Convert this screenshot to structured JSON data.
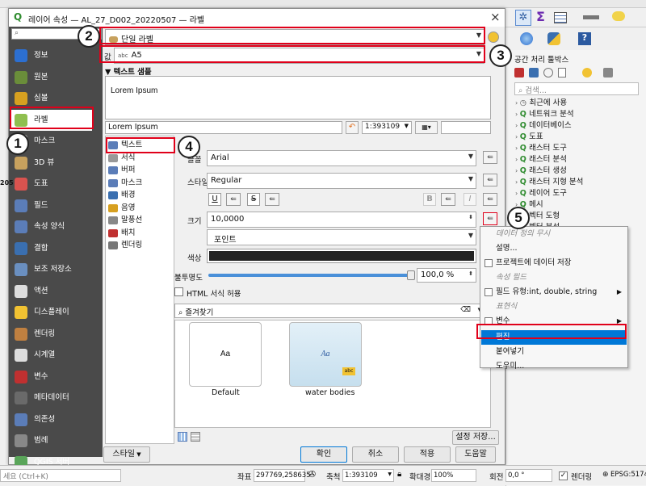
{
  "dialog": {
    "title": "레이어 속성 — AL_27_D002_20220507 — 라벨",
    "close": "×"
  },
  "sidebar": {
    "search_placeholder": "",
    "items": [
      {
        "label": "정보",
        "icon": "info-icon",
        "color": "#2c6fd1"
      },
      {
        "label": "원본",
        "icon": "source-icon",
        "color": "#6a8d3a"
      },
      {
        "label": "심볼",
        "icon": "symbology-icon",
        "color": "#d7a020"
      },
      {
        "label": "라벨",
        "icon": "labels-icon",
        "color": "#8fbf4f"
      },
      {
        "label": "마스크",
        "icon": "mask-icon",
        "color": "#999"
      },
      {
        "label": "3D 뷰",
        "icon": "3d-view-icon",
        "color": "#c7a15e"
      },
      {
        "label": "도표",
        "icon": "diagram-icon",
        "color": "#d9534f"
      },
      {
        "label": "필드",
        "icon": "fields-icon",
        "color": "#5b7db8"
      },
      {
        "label": "속성 양식",
        "icon": "attributes-form-icon",
        "color": "#5b7db8"
      },
      {
        "label": "결합",
        "icon": "joins-icon",
        "color": "#3a6fb0"
      },
      {
        "label": "보조 저장소",
        "icon": "auxiliary-storage-icon",
        "color": "#6a8fc0"
      },
      {
        "label": "액션",
        "icon": "actions-icon",
        "color": "#ddd"
      },
      {
        "label": "디스플레이",
        "icon": "display-icon",
        "color": "#f1c232"
      },
      {
        "label": "렌더링",
        "icon": "rendering-icon",
        "color": "#c08040"
      },
      {
        "label": "시계열",
        "icon": "temporal-icon",
        "color": "#ddd"
      },
      {
        "label": "변수",
        "icon": "variables-icon",
        "color": "#c03030"
      },
      {
        "label": "메타데이터",
        "icon": "metadata-icon",
        "color": "#6a6a6a"
      },
      {
        "label": "의존성",
        "icon": "dependencies-icon",
        "color": "#5b7db8"
      },
      {
        "label": "범례",
        "icon": "legend-icon",
        "color": "#888"
      },
      {
        "label": "QGIS 서버",
        "icon": "qgis-server-icon",
        "color": "#5aa55a"
      }
    ]
  },
  "main": {
    "label_mode": "단일 라벨",
    "value_label": "값",
    "value": "A5",
    "text_sample_header": "텍스트 샘플",
    "sample_text": "Lorem Ipsum",
    "sample_input": "Lorem Ipsum",
    "scale": "1:393109",
    "sub_tabs": [
      "텍스트",
      "서식",
      "버퍼",
      "마스크",
      "배경",
      "음영",
      "말풍선",
      "배치",
      "렌더링"
    ],
    "font_label": "글꼴",
    "font": "Arial",
    "style_label": "스타일",
    "style": "Regular",
    "underline": "U",
    "strike": "S",
    "bold": "B",
    "italic": "I",
    "size_label": "크기",
    "size": "10,0000",
    "unit": "포인트",
    "color_label": "색상",
    "opacity_label": "불투명도",
    "opacity": "100,0 %",
    "html_label": "HTML 서식 허용",
    "favorites": "즐겨찾기",
    "styles": [
      {
        "preview": "Aa",
        "name": "Default"
      },
      {
        "preview": "Aa",
        "name": "water bodies"
      }
    ],
    "save_style": "설정 저장...",
    "buttons": {
      "style": "스타일",
      "ok": "확인",
      "cancel": "취소",
      "apply": "적용",
      "help": "도움말"
    }
  },
  "context_menu": {
    "header1": "데이터 정의 무시",
    "items": [
      {
        "label": "설명...",
        "type": "item"
      },
      {
        "label": "프로젝트에 데이터 저장",
        "type": "check"
      },
      {
        "label": "속성 필드",
        "type": "header"
      },
      {
        "label": "필드 유형:int, double, string",
        "type": "check-sub"
      },
      {
        "label": "표현식",
        "type": "header"
      },
      {
        "label": "변수",
        "type": "check-sub"
      },
      {
        "label": "편집...",
        "type": "selected"
      },
      {
        "label": "붙여넣기",
        "type": "item"
      },
      {
        "label": "도우미...",
        "type": "item"
      }
    ]
  },
  "toolbox": {
    "title": "공간 처리 툴박스",
    "search": "검색...",
    "items": [
      "최근에 사용",
      "네트워크 분석",
      "데이터베이스",
      "도표",
      "래스터 도구",
      "래스터 분석",
      "래스터 생성",
      "래스터 지형 분석",
      "레이어 도구",
      "메시",
      "벡터 도형",
      "벡터 분석"
    ]
  },
  "statusbar": {
    "search": "세요 (Ctrl+K)",
    "coord_label": "좌표",
    "coord": "297769,258635",
    "scale_label": "축척",
    "scale": "1:393109",
    "zoom_label": "확대경",
    "zoom": "100%",
    "rotation_label": "회전",
    "rotation": "0,0 °",
    "render_label": "렌더링",
    "crs": "EPSG:5174"
  },
  "annotations": [
    "1",
    "2",
    "3",
    "4",
    "5"
  ],
  "colors": {
    "sidebar_bg": "#4a4a4a",
    "selection": "#0078d7",
    "highlight": "#e0001a"
  }
}
